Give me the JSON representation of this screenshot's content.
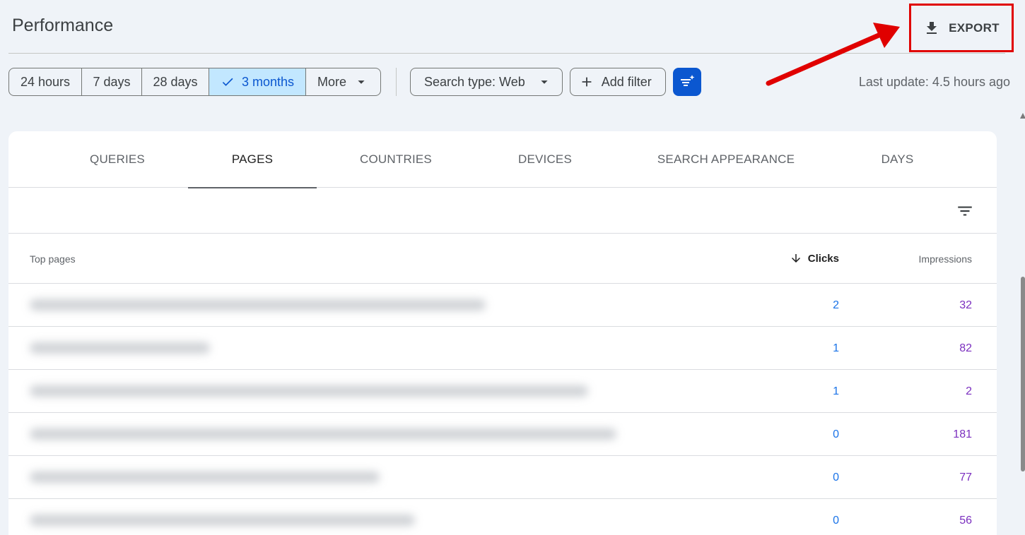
{
  "page": {
    "title": "Performance"
  },
  "export": {
    "label": "EXPORT",
    "icon": "download-icon",
    "highlight_color": "#e00000"
  },
  "date_range": {
    "options": [
      "24 hours",
      "7 days",
      "28 days",
      "3 months"
    ],
    "selected": "3 months",
    "more_label": "More"
  },
  "filters": {
    "search_type_label": "Search type: Web",
    "add_filter_label": "Add filter",
    "compare_icon": "compare-sparkle-icon"
  },
  "status": {
    "last_update": "Last update: 4.5 hours ago"
  },
  "tabs": [
    "QUERIES",
    "PAGES",
    "COUNTRIES",
    "DEVICES",
    "SEARCH APPEARANCE",
    "DAYS"
  ],
  "active_tab": "PAGES",
  "table": {
    "col_pages": "Top pages",
    "col_clicks": "Clicks",
    "col_impressions": "Impressions",
    "rows": [
      {
        "clicks": "2",
        "impressions": "32"
      },
      {
        "clicks": "1",
        "impressions": "82"
      },
      {
        "clicks": "1",
        "impressions": "2"
      },
      {
        "clicks": "0",
        "impressions": "181"
      },
      {
        "clicks": "0",
        "impressions": "77"
      },
      {
        "clicks": "0",
        "impressions": "56"
      }
    ]
  },
  "colors": {
    "accent": "#0b57d0",
    "selected_bg": "#c2e7ff",
    "clicks": "#1a73e8",
    "impressions": "#7b2fbf"
  }
}
